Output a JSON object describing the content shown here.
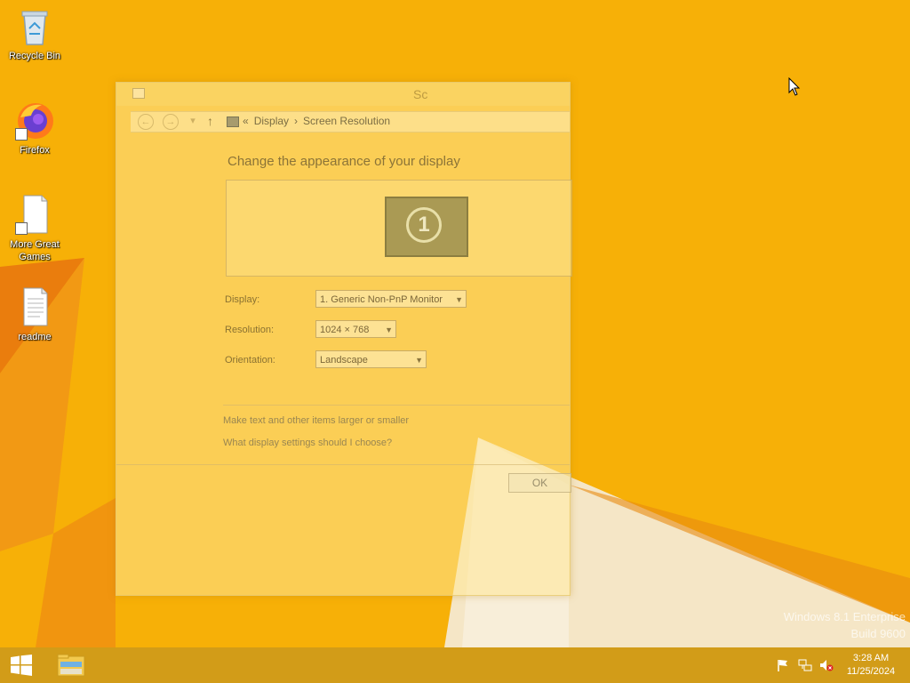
{
  "desktop": {
    "icons": [
      {
        "label": "Recycle Bin",
        "icon": "recycle-bin-icon"
      },
      {
        "label": "Firefox",
        "icon": "firefox-icon"
      },
      {
        "label": "More Great Games",
        "icon": "document-shortcut-icon"
      },
      {
        "label": "readme",
        "icon": "text-document-icon"
      }
    ],
    "wallpaper_color": "#f7b007"
  },
  "window": {
    "title_partial": "Sc",
    "breadcrumb": [
      "«",
      "Display",
      "›",
      "Screen Resolution"
    ],
    "heading": "Change the appearance of your display",
    "monitor_number": "1",
    "display": {
      "label": "Display:",
      "value": "1. Generic Non-PnP Monitor"
    },
    "resolution": {
      "label": "Resolution:",
      "value": "1024 × 768"
    },
    "orientation": {
      "label": "Orientation:",
      "value": "Landscape"
    },
    "links": {
      "text_size": "Make text and other items larger or smaller",
      "settings_help": "What display settings should I choose?"
    },
    "ok_label": "OK"
  },
  "watermark": {
    "line1": "Windows 8.1 Enterprise",
    "line2": "Build 9600"
  },
  "taskbar": {
    "time": "3:28 AM",
    "date": "11/25/2024",
    "tray_icons": [
      "action-center-flag-icon",
      "network-icon",
      "volume-muted-icon"
    ]
  }
}
